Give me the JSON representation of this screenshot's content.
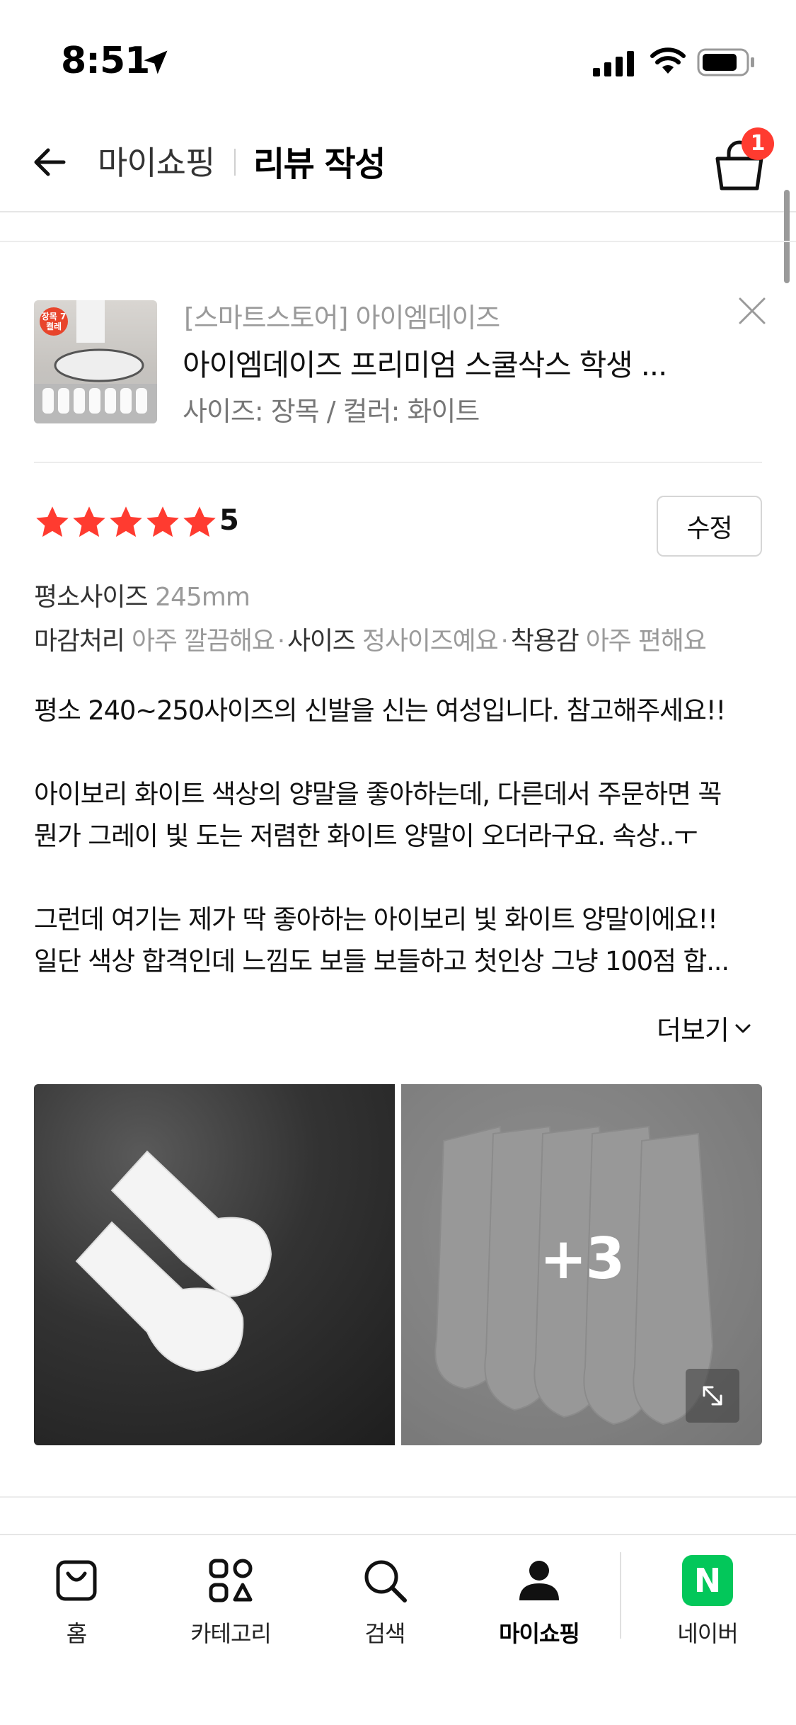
{
  "status_bar": {
    "time": "8:51"
  },
  "header": {
    "breadcrumb_parent": "마이쇼핑",
    "title": "리뷰 작성",
    "cart_badge": "1"
  },
  "product": {
    "thumb_tag": "장목 7켤레",
    "store": "[스마트스토어] 아이엠데이즈",
    "name": "아이엠데이즈 프리미엄 스쿨삭스 학생 ...",
    "option": "사이즈: 장목 / 컬러: 화이트"
  },
  "rating": {
    "stars": 5,
    "score": "5",
    "edit_label": "수정"
  },
  "attributes": {
    "size_label": "평소사이즈",
    "size_value": "245mm",
    "items": [
      {
        "key": "마감처리",
        "value": "아주 깔끔해요"
      },
      {
        "key": "사이즈",
        "value": "정사이즈예요"
      },
      {
        "key": "착용감",
        "value": "아주 편해요"
      }
    ]
  },
  "review": {
    "line1": "평소 240~250사이즈의 신발을 신는 여성입니다. 참고해주세요!!",
    "line2": "아이보리 화이트 색상의 양말을 좋아하는데, 다른데서 주문하면 꼭",
    "line3": "뭔가 그레이 빛 도는 저렴한 화이트 양말이 오더라구요. 속상..ㅜ",
    "line4": "그런데 여기는 제가 딱 좋아하는 아이보리 빛 화이트 양말이에요!!",
    "line5": "일단 색상 합격인데 느낌도 보들 보들하고 첫인상 그냥 100점 합...",
    "more_label": "더보기"
  },
  "photos": {
    "extra_count": "+3"
  },
  "tabbar": {
    "items": [
      {
        "label": "홈",
        "icon": "bag-icon"
      },
      {
        "label": "카테고리",
        "icon": "category-icon"
      },
      {
        "label": "검색",
        "icon": "search-icon"
      },
      {
        "label": "마이쇼핑",
        "icon": "person-icon",
        "active": true
      },
      {
        "label": "네이버",
        "icon": "naver-icon"
      }
    ],
    "naver_letter": "N"
  },
  "colors": {
    "star": "#ff3b30",
    "badge": "#ff3b30",
    "naver_green": "#03c75a"
  }
}
